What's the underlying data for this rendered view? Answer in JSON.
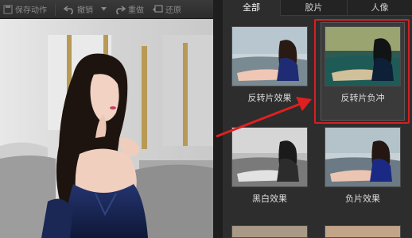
{
  "toolbar": {
    "save_action": "保存动作",
    "undo": "撤销",
    "redo": "重做",
    "restore": "还原"
  },
  "tabs": [
    {
      "label": "全部",
      "active": true
    },
    {
      "label": "胶片",
      "active": false
    },
    {
      "label": "人像",
      "active": false
    }
  ],
  "effects": [
    {
      "label": "反转片效果",
      "selected": false
    },
    {
      "label": "反转片负冲",
      "selected": true
    },
    {
      "label": "黑白效果",
      "selected": false
    },
    {
      "label": "负片效果",
      "selected": false
    }
  ],
  "colors": {
    "highlight": "#d41f24",
    "arrow": "#e02020",
    "panel_bg": "#2d2d2d"
  },
  "icons": [
    "save-action-icon",
    "undo-icon",
    "dropdown-icon",
    "redo-icon",
    "restore-icon"
  ]
}
